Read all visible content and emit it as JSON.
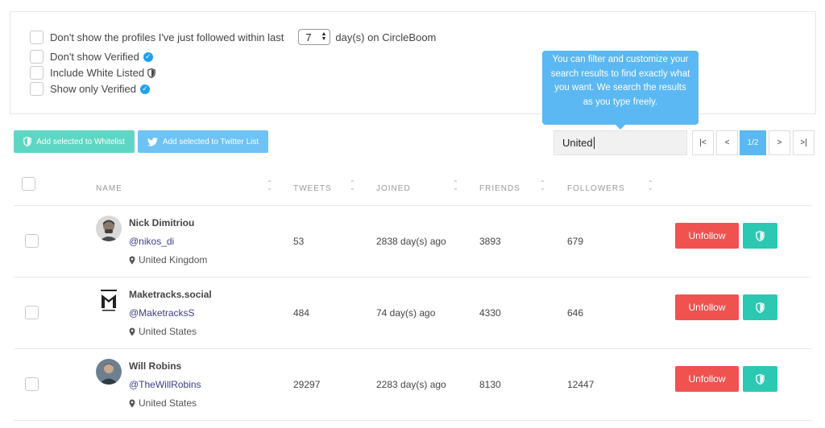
{
  "filters": {
    "hide_followed_prefix": "Don't show the profiles I've just followed within last",
    "days_value": "7",
    "hide_followed_suffix": "day(s) on CircleBoom",
    "dont_show_verified": "Don't show Verified",
    "include_whitelisted": "Include White Listed",
    "show_only_verified": "Show only Verified"
  },
  "tooltip": {
    "text": "You can filter and customize your search results to find exactly what you want. We search the results as you type freely."
  },
  "actions": {
    "whitelist": "Add selected to Whitelist",
    "twitter_list": "Add selected to Twitter List"
  },
  "search": {
    "value": "United"
  },
  "pagination": {
    "first": "|<",
    "prev": "<",
    "current": "1/2",
    "next": ">",
    "last": ">|"
  },
  "table": {
    "headers": {
      "name": "NAME",
      "tweets": "TWEETS",
      "joined": "JOINED",
      "friends": "FRIENDS",
      "followers": "FOLLOWERS"
    },
    "unfollow_label": "Unfollow",
    "rows": [
      {
        "name": "Nick Dimitriou",
        "handle": "@nikos_di",
        "location": "United Kingdom",
        "tweets": "53",
        "joined": "2838 day(s) ago",
        "friends": "3893",
        "followers": "679"
      },
      {
        "name": "Maketracks.social",
        "handle": "@MaketracksS",
        "location": "United States",
        "tweets": "484",
        "joined": "74 day(s) ago",
        "friends": "4330",
        "followers": "646"
      },
      {
        "name": "Will Robins",
        "handle": "@TheWillRobins",
        "location": "United States",
        "tweets": "29297",
        "joined": "2283 day(s) ago",
        "friends": "8130",
        "followers": "12447"
      }
    ]
  },
  "colors": {
    "accent": "#5bb8f2",
    "unfollow": "#f0524f",
    "whitelist": "#2cc8b2",
    "verified": "#1da1f2"
  }
}
